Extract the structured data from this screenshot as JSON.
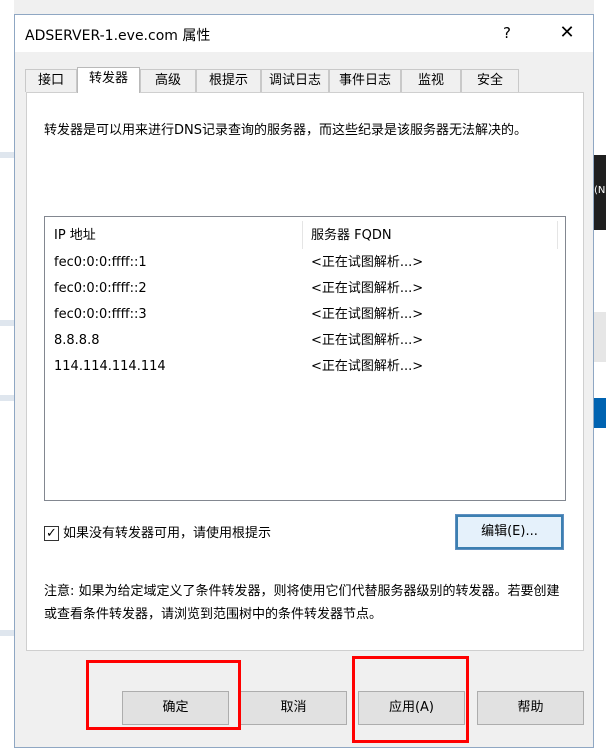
{
  "window": {
    "title": "ADSERVER-1.eve.com 属性",
    "help_glyph": "?",
    "close_glyph": "✕"
  },
  "tabs": [
    {
      "label": "接口"
    },
    {
      "label": "转发器"
    },
    {
      "label": "高级"
    },
    {
      "label": "根提示"
    },
    {
      "label": "调试日志"
    },
    {
      "label": "事件日志"
    },
    {
      "label": "监视"
    },
    {
      "label": "安全"
    }
  ],
  "active_tab": "转发器",
  "forwarders": {
    "intro": "转发器是可以用来进行DNS记录查询的服务器，而这些纪录是该服务器无法解决的。",
    "columns": {
      "ip": "IP 地址",
      "fqdn": "服务器 FQDN"
    },
    "rows": [
      {
        "ip": "fec0:0:0:ffff::1",
        "fqdn": "<正在试图解析...>"
      },
      {
        "ip": "fec0:0:0:ffff::2",
        "fqdn": "<正在试图解析...>"
      },
      {
        "ip": "fec0:0:0:ffff::3",
        "fqdn": "<正在试图解析...>"
      },
      {
        "ip": "8.8.8.8",
        "fqdn": "<正在试图解析...>"
      },
      {
        "ip": "114.114.114.114",
        "fqdn": "<正在试图解析...>"
      }
    ],
    "use_root_hints": {
      "checked": true,
      "check_glyph": "✓",
      "label": "如果没有转发器可用，请使用根提示"
    },
    "edit_label": "编辑(E)...",
    "note": "注意: 如果为给定域定义了条件转发器，则将使用它们代替服务器级别的转发器。若要创建或查看条件转发器，请浏览到范围树中的条件转发器节点。"
  },
  "buttons": {
    "ok": "确定",
    "cancel": "取消",
    "apply": "应用(A)",
    "help": "帮助"
  },
  "background": {
    "right_text": "(N"
  },
  "colors": {
    "highlight": "#ff0000",
    "accent": "#3c7fb1"
  }
}
